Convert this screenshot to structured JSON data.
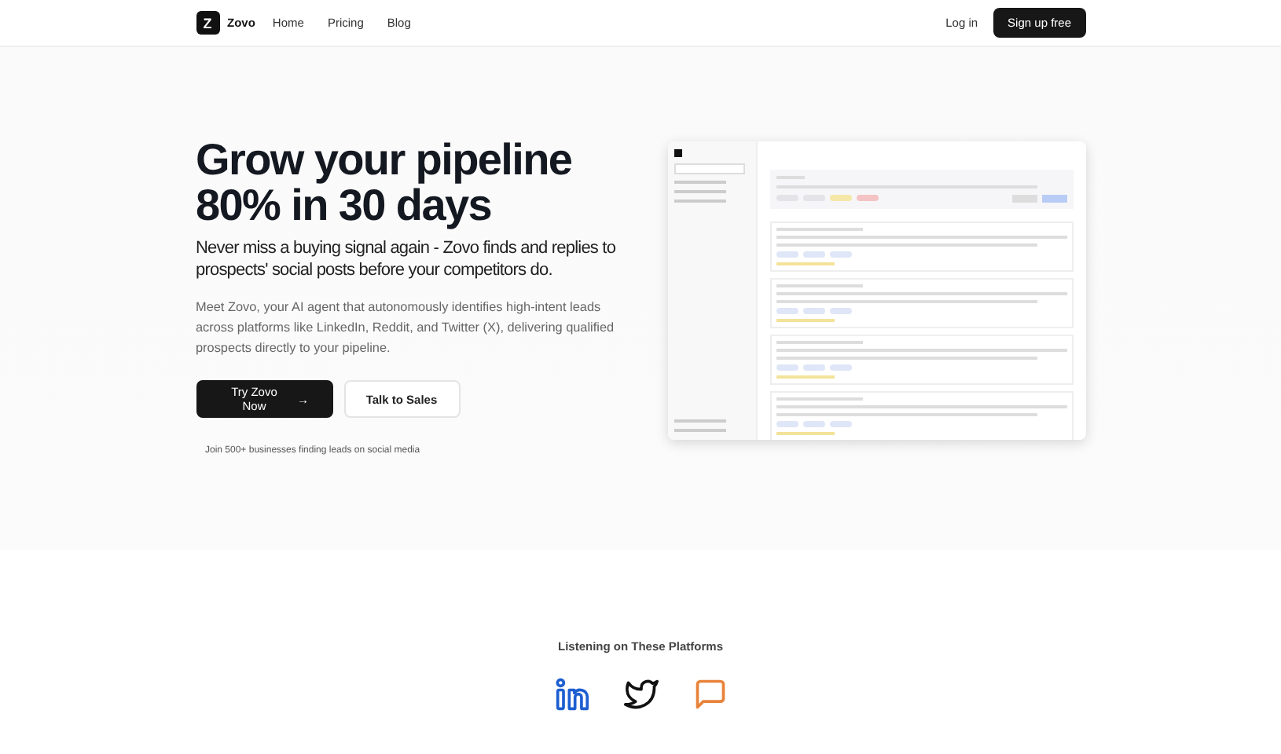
{
  "nav": {
    "logo_mark": "Z",
    "brand": "Zovo",
    "links": [
      {
        "label": "Home"
      },
      {
        "label": "Pricing"
      },
      {
        "label": "Blog"
      }
    ],
    "login": "Log in",
    "signup": "Sign up free"
  },
  "hero": {
    "title_lines": [
      "Grow your pipeline",
      "80% in 30 days"
    ],
    "subtitle": "Never miss a buying signal again - Zovo finds and replies to prospects' social posts before your competitors do.",
    "description": "Meet Zovo, your AI agent that autonomously identifies high-intent leads across platforms like LinkedIn, Reddit, and Twitter (X), delivering qualified prospects directly to your pipeline.",
    "buttons": [
      {
        "label": "Try Zovo Now",
        "kind": "primary",
        "arrow": "→"
      },
      {
        "label": "Talk to Sales",
        "kind": "secondary"
      }
    ],
    "social_proof": "Join 500+ businesses finding leads on social media"
  },
  "platforms": {
    "heading": "Listening on These Platforms",
    "items": [
      {
        "kind": "linkedin"
      },
      {
        "kind": "twitter"
      },
      {
        "kind": "chat"
      }
    ]
  }
}
